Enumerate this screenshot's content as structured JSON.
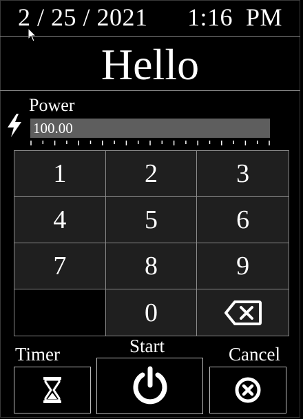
{
  "header": {
    "date": "2 / 25 / 2021",
    "time": "1:16  PM"
  },
  "greeting": "Hello",
  "power": {
    "label": "Power",
    "value": "100.00",
    "level_percent": 100
  },
  "keypad": {
    "keys": [
      "1",
      "2",
      "3",
      "4",
      "5",
      "6",
      "7",
      "8",
      "9",
      "",
      "0"
    ]
  },
  "controls": {
    "timer_label": "Timer",
    "start_label": "Start",
    "cancel_label": "Cancel"
  },
  "icons": {
    "power": "lightning-bolt-icon",
    "backspace": "backspace-icon",
    "timer": "hourglass-icon",
    "start": "power-icon",
    "cancel": "cancel-circle-x-icon"
  }
}
